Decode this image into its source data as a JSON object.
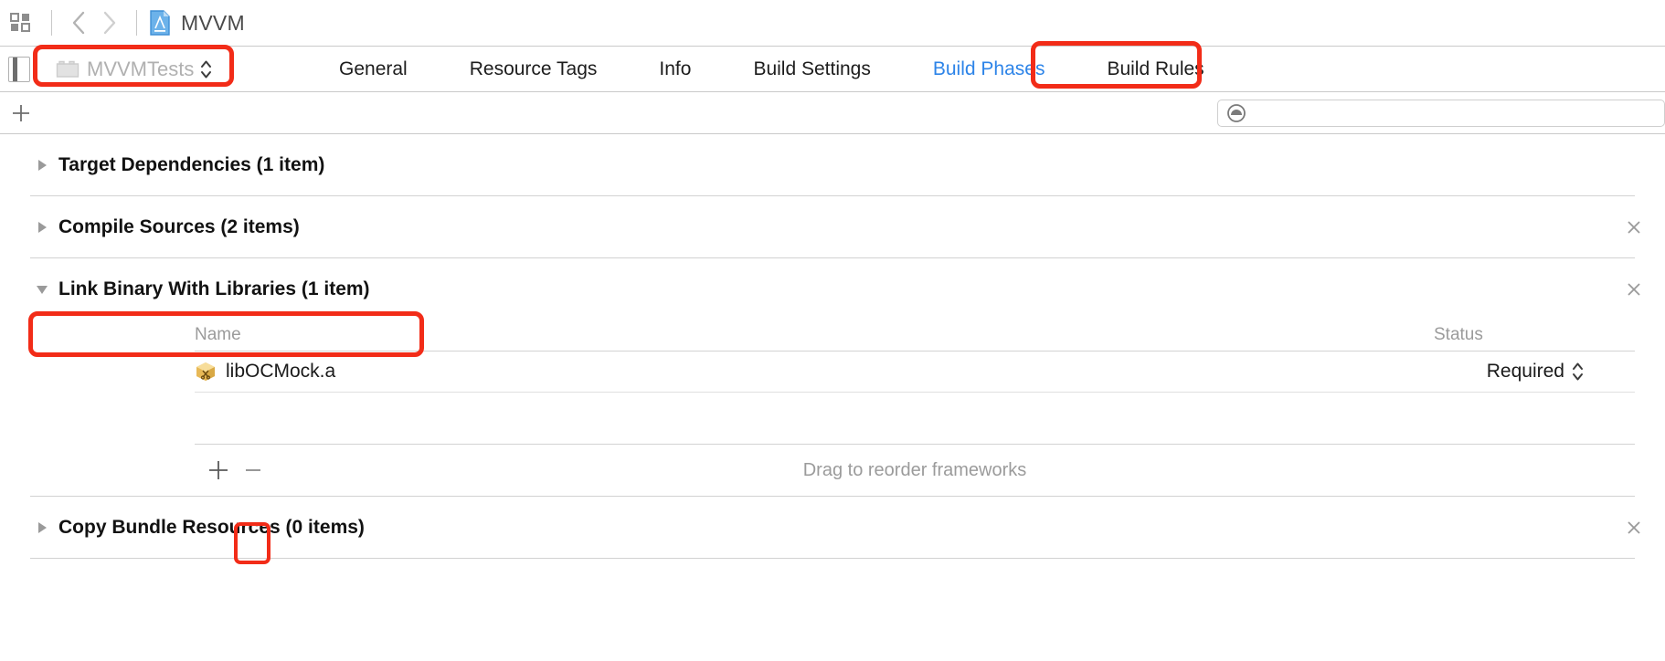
{
  "window": {
    "breadcrumb_project": "MVVM",
    "back_icon": "chevron-left-icon",
    "forward_icon": "chevron-right-icon",
    "grid_icon": "project-navigator-icon",
    "document_icon": "xcode-project-document-icon"
  },
  "target": {
    "name": "MVVMTests",
    "folder_icon": "folder-icon",
    "stepper_icon": "stepper-up-down-icon"
  },
  "tabs": [
    {
      "label": "General",
      "active": false
    },
    {
      "label": "Resource Tags",
      "active": false
    },
    {
      "label": "Info",
      "active": false
    },
    {
      "label": "Build Settings",
      "active": false
    },
    {
      "label": "Build Phases",
      "active": true
    },
    {
      "label": "Build Rules",
      "active": false
    }
  ],
  "toolbar": {
    "add_phase_label": "+",
    "add_phase_icon": "plus-icon"
  },
  "search": {
    "value": "",
    "placeholder": "",
    "icon": "search-filter-icon"
  },
  "phases": [
    {
      "title": "Target Dependencies (1 item)",
      "expanded": false,
      "disclosure_icon": "triangle-right-icon",
      "has_close": false,
      "close_icon": "close-icon"
    },
    {
      "title": "Compile Sources (2 items)",
      "expanded": false,
      "disclosure_icon": "triangle-right-icon",
      "has_close": true,
      "close_icon": "close-icon"
    },
    {
      "title": "Link Binary With Libraries (1 item)",
      "expanded": true,
      "disclosure_icon": "triangle-down-icon",
      "has_close": true,
      "close_icon": "close-icon"
    },
    {
      "title": "Copy Bundle Resources (0 items)",
      "expanded": false,
      "disclosure_icon": "triangle-right-icon",
      "has_close": true,
      "close_icon": "close-icon"
    }
  ],
  "libraries_table": {
    "columns": {
      "name": "Name",
      "status": "Status"
    },
    "rows": [
      {
        "name": "libOCMock.a",
        "status": "Required",
        "icon": "static-library-icon",
        "status_stepper_icon": "stepper-up-down-icon"
      }
    ],
    "footer": {
      "add_icon": "plus-icon",
      "remove_icon": "minus-icon",
      "hint": "Drag to reorder frameworks"
    }
  },
  "annotations": {
    "color": "#f22c18",
    "items": [
      {
        "name": "target-selector-highlight"
      },
      {
        "name": "build-phases-tab-highlight"
      },
      {
        "name": "link-binary-phase-highlight"
      },
      {
        "name": "add-framework-button-highlight"
      }
    ]
  }
}
